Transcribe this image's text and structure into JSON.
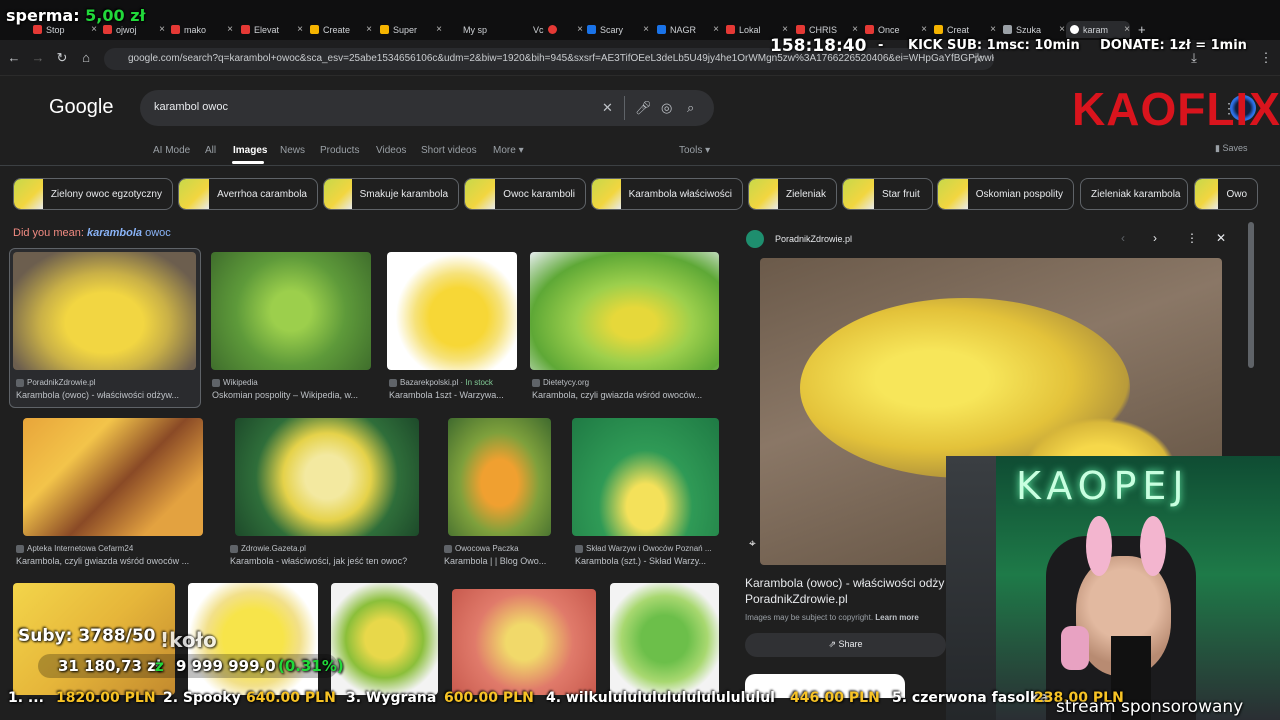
{
  "overlay": {
    "sperma_label": "sperma:",
    "sperma_value": "5,00 zł",
    "timer": "158:18:40",
    "dash": "-",
    "kick_sub": "KICK SUB: 1msc: 10min",
    "donate": "DONATE: 1zł = 1min",
    "brand": "KAOFLIX",
    "subs": "Suby: 3788/50",
    "kolo": "!koło",
    "money_left": "31 180,73 zł",
    "money_mid": "z",
    "money_goal": "9 999 999,0",
    "money_pct": "(0.31%)",
    "sponsor": "stream sponsorowany",
    "neon": "KAOPEJ",
    "ticker": [
      {
        "rank": "1. ...",
        "amount": "1820.00 PLN"
      },
      {
        "rank": "2. Spooky",
        "amount": "640.00 PLN"
      },
      {
        "rank": "3. Wygrana",
        "amount": "600.00 PLN"
      },
      {
        "rank": "4. wilkulululululululululululul",
        "amount": "446.00 PLN"
      },
      {
        "rank": "5. czerwona fasolka",
        "amount": "238.00 PLN"
      }
    ]
  },
  "browser": {
    "tabs": [
      "Stop",
      "ojwoj",
      "mako",
      "Elevat",
      "Create",
      "Super",
      "My sp",
      "Vc",
      "Scary",
      "NAGR",
      "Lokal",
      "CHRIS",
      "Once",
      "Creat",
      "Szuka",
      "karam"
    ],
    "url": "google.com/search?q=karambol+owoc&sca_esv=25abe1534656106c&udm=2&biw=1920&bih=945&sxsrf=AE3TifOEeL3deLb5U49jy4he1OrWMgn5zw%3A1766226520406&ei=WHpGaYfBGPjwwPAPxM"
  },
  "google": {
    "logo": "Google",
    "query": "karambol owoc",
    "nav": [
      "AI Mode",
      "All",
      "Images",
      "News",
      "Products",
      "Videos",
      "Short videos",
      "More"
    ],
    "tools": "Tools",
    "saves": "Saves",
    "chips": [
      "Zielony owoc egzotyczny",
      "Averrhoa carambola",
      "Smakuje karambola",
      "Owoc karamboli",
      "Karambola właściwości",
      "Zieleniak",
      "Star fruit",
      "Oskomian pospolity",
      "Zieleniak karambola",
      "Owo"
    ],
    "did_you_mean": "Did you mean:",
    "suggest_bold": "karambola",
    "suggest_rest": "owoc"
  },
  "results": [
    {
      "source": "PoradnikZdrowie.pl",
      "title": "Karambola (owoc) - właściwości odżyw..."
    },
    {
      "source": "Wikipedia",
      "title": "Oskomian pospolity – Wikipedia, w..."
    },
    {
      "source": "Bazarekpolski.pl",
      "stock": "In stock",
      "title": "Karambola 1szt - Warzywa..."
    },
    {
      "source": "Dietetycy.org",
      "title": "Karambola, czyli gwiazda wśród owoców..."
    },
    {
      "source": "Apteka Internetowa Cefarm24",
      "title": "Karambola, czyli gwiazda wśród owoców ..."
    },
    {
      "source": "Zdrowie.Gazeta.pl",
      "title": "Karambola - właściwości, jak jeść ten owoc?"
    },
    {
      "source": "Owocowa Paczka",
      "title": "Karambola | | Blog Owo..."
    },
    {
      "source": "Skład Warzyw i Owoców Poznań ...",
      "title": "Karambola (szt.) - Skład Warzy..."
    }
  ],
  "panel": {
    "source": "PoradnikZdrowie.pl",
    "title": "Karambola (owoc) - właściwości odży",
    "site": "PoradnikZdrowie.pl",
    "copyright": "Images may be subject to copyright.",
    "learn_more": "Learn more",
    "share": "Share"
  }
}
